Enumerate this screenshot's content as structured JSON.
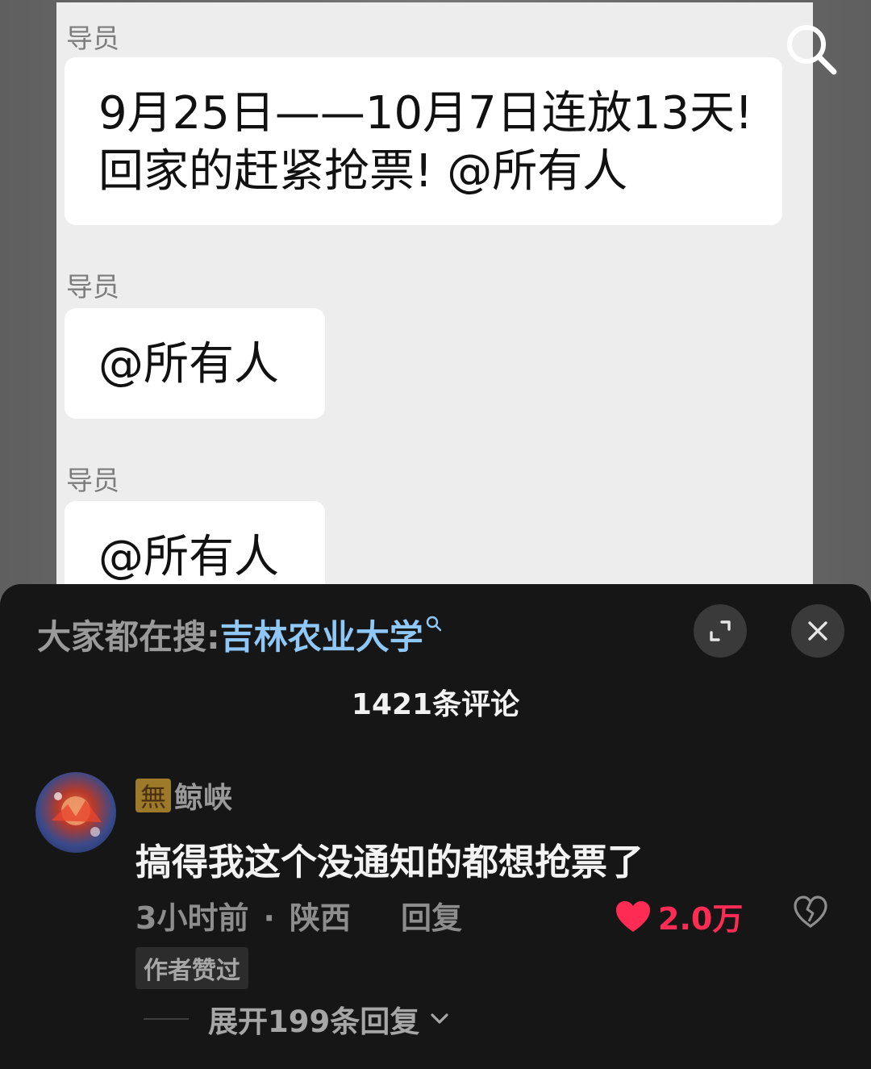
{
  "chat": {
    "messages": [
      {
        "sender": "导员",
        "lines": [
          "9月25日——10月7日连放13天!",
          "回家的赶紧抢票! @所有人"
        ]
      },
      {
        "sender": "导员",
        "lines": [
          "@所有人"
        ]
      },
      {
        "sender": "导员",
        "lines": [
          "@所有人"
        ]
      }
    ]
  },
  "icons": {
    "overlay_search": "search-icon",
    "expand": "fullscreen-icon",
    "close": "close-icon",
    "like": "heart-icon",
    "dislike": "broken-heart-icon",
    "chevron": "chevron-down-icon"
  },
  "comments_panel": {
    "hot_search_prefix": "大家都在搜:",
    "hot_search_keyword": "吉林农业大学",
    "comment_count": "1421条评论",
    "comment": {
      "badge": "無",
      "username": "鲸峡",
      "text": "搞得我这个没通知的都想抢票了",
      "time": "3小时前",
      "separator": "·",
      "location": "陕西",
      "reply_label": "回复",
      "likes": "2.0万",
      "author_liked": "作者赞过",
      "expand_replies": "展开199条回复"
    }
  },
  "colors": {
    "accent_like": "#fe2c55",
    "keyword_blue": "#8fc7f7",
    "sheet_bg": "#161616"
  }
}
